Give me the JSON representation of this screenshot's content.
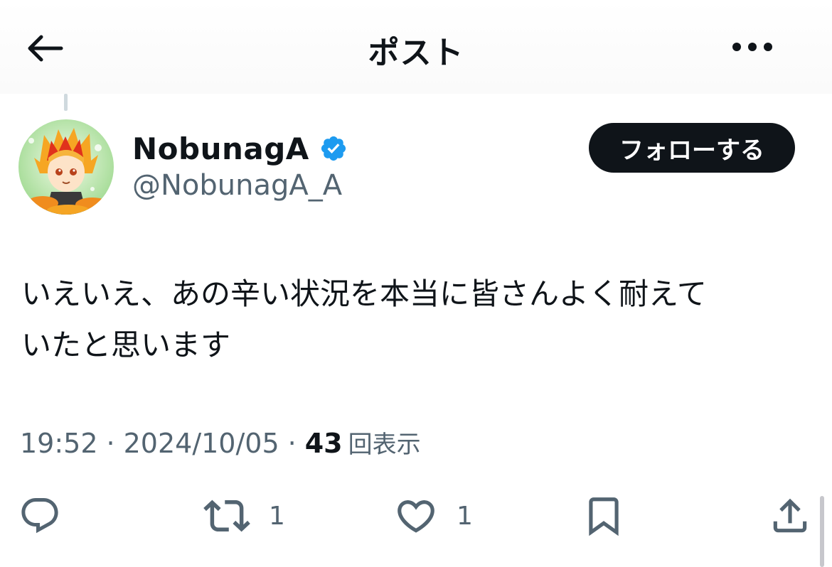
{
  "header": {
    "title": "ポスト",
    "back_icon": "arrow-left-icon",
    "more_icon": "ellipsis-icon"
  },
  "author": {
    "display_name": "NobunagA",
    "handle": "@NobunagA_A",
    "verified": true,
    "avatar_icon": "avatar-illustration"
  },
  "follow_button": {
    "label": "フォローする"
  },
  "post": {
    "text": "いえいえ、あの辛い状況を本当に皆さんよく耐えて\nいたと思います"
  },
  "meta": {
    "time": "19:52",
    "separator": "·",
    "date": "2024/10/05",
    "views_count": "43",
    "views_label": "回表示"
  },
  "actions": {
    "reply": {
      "icon": "reply-icon",
      "count": ""
    },
    "repost": {
      "icon": "repost-icon",
      "count": "1"
    },
    "like": {
      "icon": "heart-icon",
      "count": "1"
    },
    "bookmark": {
      "icon": "bookmark-icon",
      "count": ""
    },
    "share": {
      "icon": "share-icon",
      "count": ""
    }
  },
  "colors": {
    "text_primary": "#0f1419",
    "text_secondary": "#536471",
    "verified_blue": "#1d9bf0",
    "button_dark": "#0f1419"
  }
}
